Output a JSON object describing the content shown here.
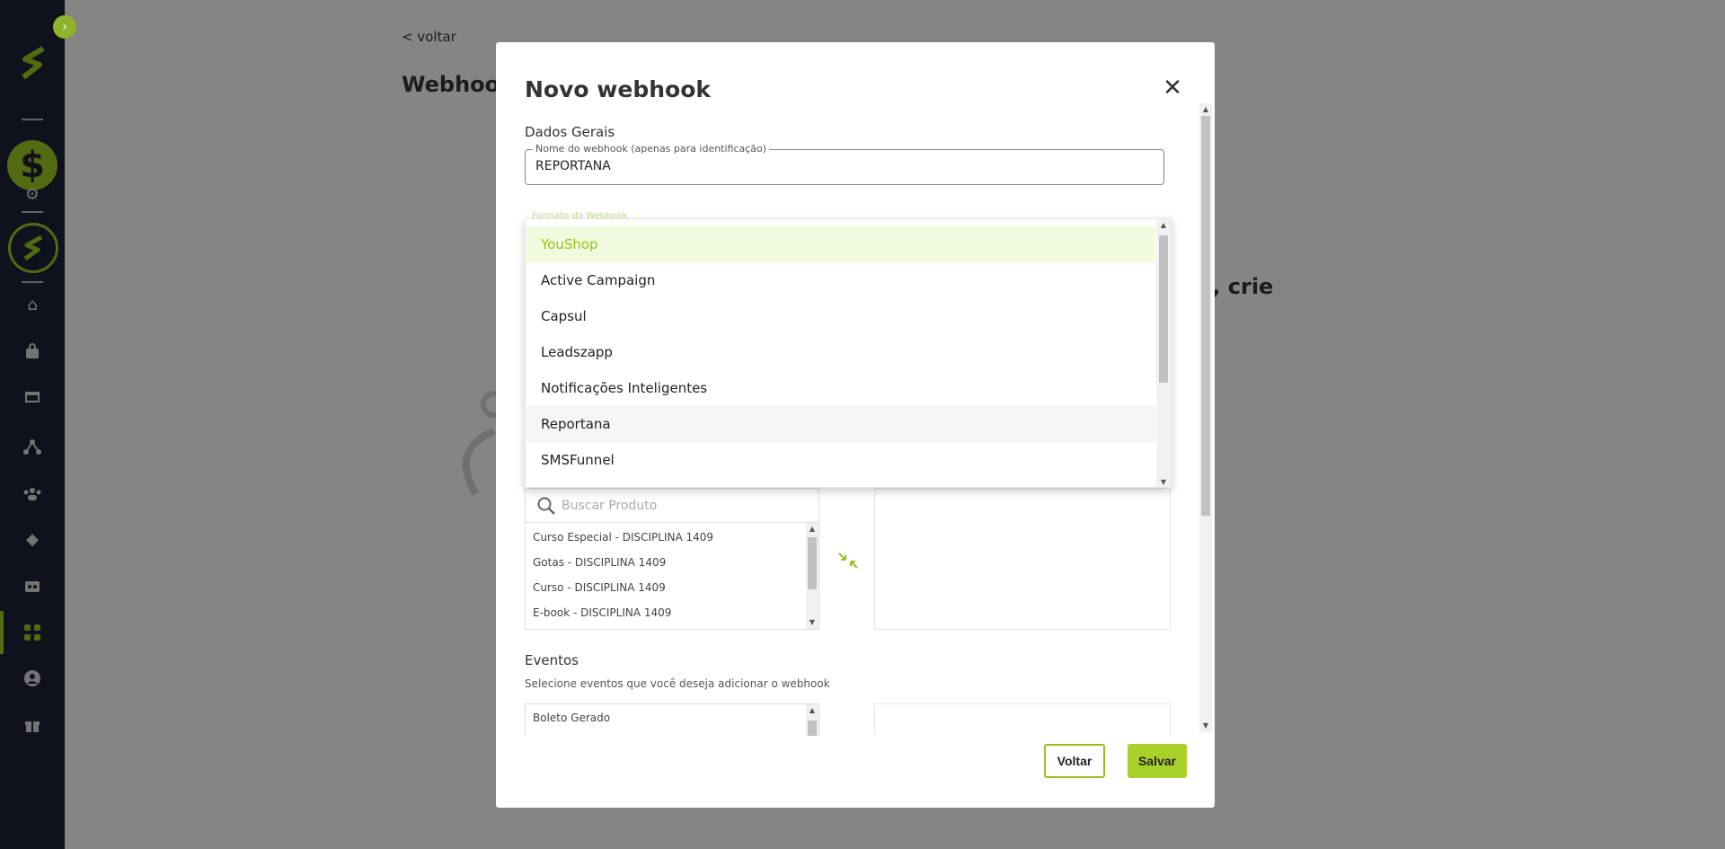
{
  "background_page": {
    "back_link": "< voltar",
    "title": "Webhook",
    "empty_text_fragment": "s, crie"
  },
  "modal": {
    "title": "Novo webhook",
    "general_section": "Dados Gerais",
    "name_field": {
      "legend": "Nome do webhook (apenas para identificação)",
      "value": "REPORTANA"
    },
    "format_field_legend": "Formato do Webhook",
    "format_options": [
      {
        "label": "YouShop",
        "state": "selected"
      },
      {
        "label": "Active Campaign",
        "state": "normal"
      },
      {
        "label": "Capsul",
        "state": "normal"
      },
      {
        "label": "Leadszapp",
        "state": "normal"
      },
      {
        "label": "Notificações Inteligentes",
        "state": "normal"
      },
      {
        "label": "Reportana",
        "state": "hover"
      },
      {
        "label": "SMSFunnel",
        "state": "normal"
      }
    ],
    "product_search_placeholder": "Buscar Produto",
    "products": [
      "Curso Especial - DISCIPLINA 1409",
      "Gotas - DISCIPLINA 1409",
      "Curso - DISCIPLINA 1409",
      "E-book - DISCIPLINA 1409"
    ],
    "events_section": "Eventos",
    "events_subtitle": "Selecione eventos que você deseja adicionar o webhook",
    "events": [
      "Boleto Gerado"
    ],
    "back_button": "Voltar",
    "save_button": "Salvar"
  },
  "colors": {
    "brand": "#95c11f",
    "sidebar_bg": "#1c2234",
    "selected_bg": "#f1fadc"
  },
  "icons": [
    "expand-icon",
    "logo-icon",
    "dollar-icon",
    "gear-icon",
    "school-icon",
    "bag-icon",
    "sales-icon",
    "affiliates-icon",
    "people-icon",
    "diamond-icon",
    "wallet-icon",
    "apps-icon",
    "user-icon",
    "gift-icon",
    "close-icon",
    "search-icon",
    "transfer-icon"
  ]
}
